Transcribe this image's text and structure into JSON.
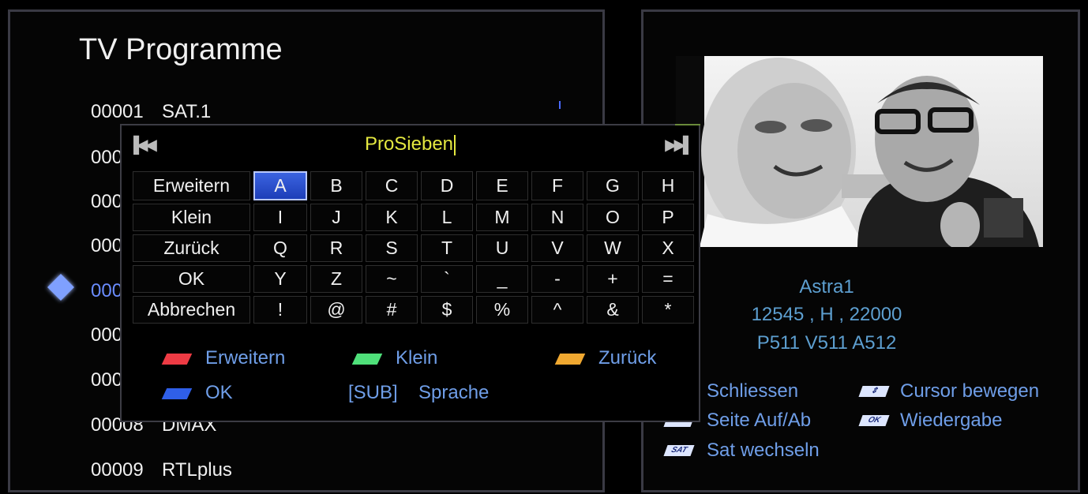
{
  "channel_list": {
    "title": "TV Programme",
    "rows": [
      {
        "number": "00001",
        "name": "SAT.1"
      },
      {
        "number": "000",
        "name": ""
      },
      {
        "number": "000",
        "name": ""
      },
      {
        "number": "000",
        "name": ""
      },
      {
        "number": "000",
        "name": ""
      },
      {
        "number": "000",
        "name": ""
      },
      {
        "number": "000",
        "name": ""
      },
      {
        "number": "00008",
        "name": "DMAX"
      },
      {
        "number": "00009",
        "name": "RTLplus"
      }
    ]
  },
  "keyboard": {
    "input_value": "ProSieben",
    "first_icon": "skip-first-icon",
    "last_icon": "skip-last-icon",
    "rows": [
      {
        "function": "Erweitern",
        "keys": [
          "A",
          "B",
          "C",
          "D",
          "E",
          "F",
          "G",
          "H"
        ]
      },
      {
        "function": "Klein",
        "keys": [
          "I",
          "J",
          "K",
          "L",
          "M",
          "N",
          "O",
          "P"
        ]
      },
      {
        "function": "Zurück",
        "keys": [
          "Q",
          "R",
          "S",
          "T",
          "U",
          "V",
          "W",
          "X"
        ]
      },
      {
        "function": "OK",
        "keys": [
          "Y",
          "Z",
          "~",
          "`",
          "_",
          "-",
          "+",
          "="
        ]
      },
      {
        "function": "Abbrechen",
        "keys": [
          "!",
          "@",
          "#",
          "$",
          "%",
          "^",
          "&",
          "*"
        ]
      }
    ],
    "selected_key": "A",
    "legend": {
      "red": "Erweitern",
      "green": "Klein",
      "yellow": "Zurück",
      "blue": "OK",
      "sub_key": "[SUB]",
      "sub_label": "Sprache"
    },
    "colors": {
      "red": "#ee3b44",
      "green": "#4fe07a",
      "yellow": "#f0a830",
      "blue": "#2f5fe8",
      "input": "#e4e840",
      "selected": "#2a4fd0"
    }
  },
  "sat_info": {
    "satellite": "Astra1",
    "transponder": "12545 , H , 22000",
    "pids": "P511  V511  A512"
  },
  "help": {
    "close": "Schliessen",
    "cursor": "Cursor bewegen",
    "page": "Seite Auf/Ab",
    "play": "Wiedergabe",
    "sat": "Sat wechseln",
    "ok_icon_text": "OK",
    "sat_icon_text": "SAT"
  }
}
